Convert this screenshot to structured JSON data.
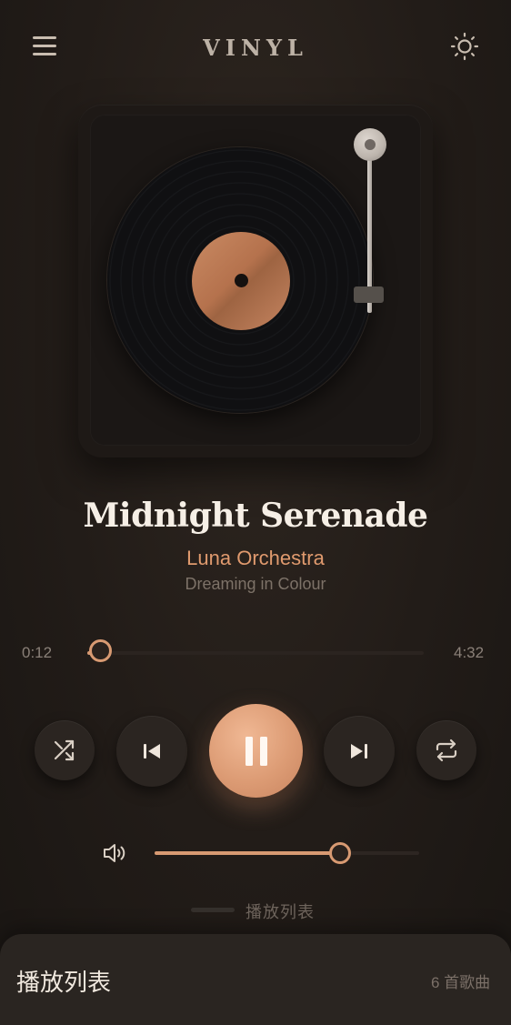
{
  "header": {
    "logo": "VINYL",
    "menu_icon": "hamburger-icon",
    "theme_icon": "sun-icon"
  },
  "colors": {
    "accent": "#d89a72",
    "background": "#221c18",
    "record_label": "#b5724d"
  },
  "track": {
    "title": "Midnight Serenade",
    "artist": "Luna Orchestra",
    "album": "Dreaming in Colour"
  },
  "progress": {
    "current": "0:12",
    "total": "4:32",
    "fraction": 0.046
  },
  "controls": {
    "shuffle_icon": "shuffle-icon",
    "prev_icon": "skip-previous-icon",
    "play_icon": "pause-icon",
    "next_icon": "skip-next-icon",
    "repeat_icon": "repeat-icon"
  },
  "volume": {
    "icon": "volume-icon",
    "level": 0.7
  },
  "playlist": {
    "toggle_label": "播放列表",
    "title": "播放列表",
    "count": "6 首歌曲"
  }
}
